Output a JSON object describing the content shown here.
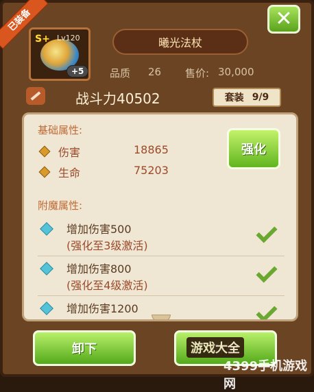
{
  "badge": {
    "equipped": "已装备"
  },
  "close": {
    "icon": "close-icon"
  },
  "item": {
    "grade": "S+",
    "level": "Lv120",
    "enhance_level": "+5",
    "name": "曦光法杖",
    "quality_label": "品质",
    "quality_value": "26",
    "price_label": "售价:",
    "price_value": "30,000"
  },
  "power": {
    "label": "战斗力40502",
    "set_label": "套装",
    "set_value": "9/9"
  },
  "base_attributes": {
    "title": "基础属性:",
    "items": [
      {
        "name": "伤害",
        "value": "18865"
      },
      {
        "name": "生命",
        "value": "75203"
      }
    ]
  },
  "enhance_button": "强化",
  "enchant_attributes": {
    "title": "附魔属性:",
    "items": [
      {
        "bonus": "增加伤害500",
        "condition": "(强化至3级激活)"
      },
      {
        "bonus": "增加伤害800",
        "condition": "(强化至4级激活)"
      },
      {
        "bonus": "增加伤害1200",
        "condition": ""
      }
    ]
  },
  "buttons": {
    "unequip": "卸下",
    "upgrade": "升级"
  },
  "watermark": {
    "text": "游戏大全",
    "site": "4399手机游戏网"
  }
}
